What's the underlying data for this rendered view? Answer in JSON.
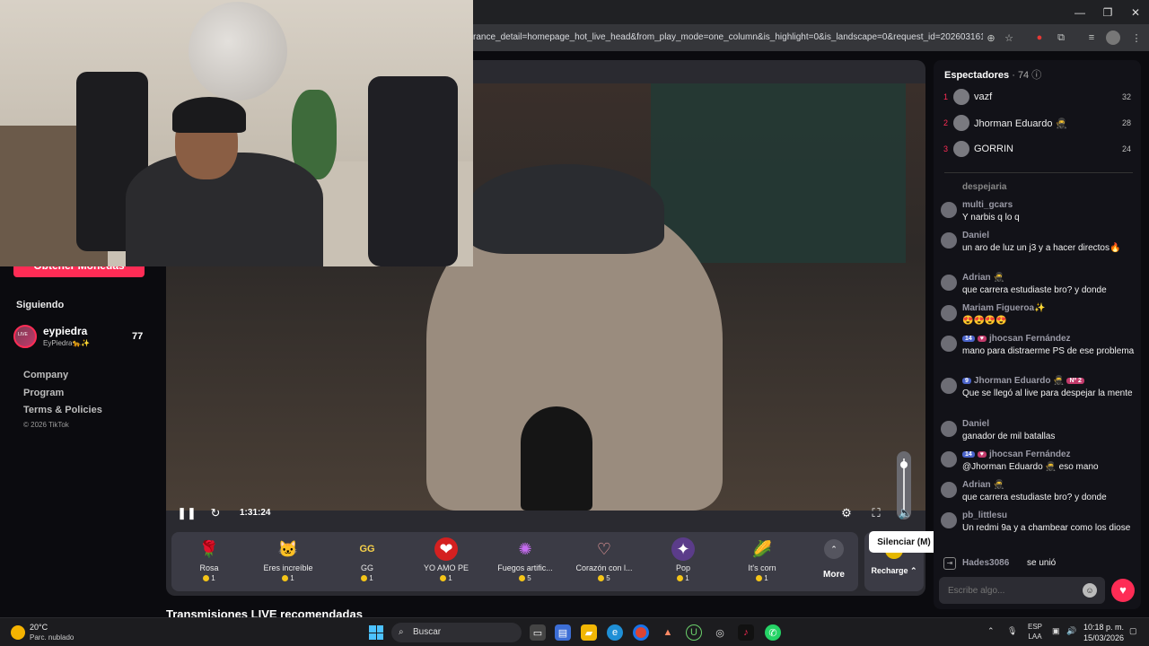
{
  "browser": {
    "url": "rance_detail=homepage_hot_live_head&from_play_mode=one_column&is_highlight=0&is_landscape=0&request_id=20260316111004..."
  },
  "sidebar": {
    "cta_label": "Obtener Monedas",
    "following_title": "Siguiendo",
    "following": [
      {
        "name": "eypiedra",
        "sub": "EyPiedra🐆✨",
        "count": "77",
        "live_tag": "LIVE"
      }
    ],
    "links": [
      "Company",
      "Program",
      "Terms & Policies"
    ],
    "copyright": "© 2026 TikTok"
  },
  "player": {
    "time": "1:31:24",
    "mute_tooltip": "Silenciar (M)",
    "gifts": [
      {
        "name": "Rosa",
        "price": "1",
        "icon": "🌹"
      },
      {
        "name": "Eres increíble",
        "price": "1",
        "icon": "🐱"
      },
      {
        "name": "GG",
        "price": "1",
        "icon": "GG"
      },
      {
        "name": "YO AMO PE",
        "price": "1",
        "icon": "❤"
      },
      {
        "name": "Fuegos artific...",
        "price": "5",
        "icon": "✺"
      },
      {
        "name": "Corazón con l...",
        "price": "5",
        "icon": "♡"
      },
      {
        "name": "Pop",
        "price": "1",
        "icon": "✦"
      },
      {
        "name": "It's corn",
        "price": "1",
        "icon": "🌽"
      }
    ],
    "more_label": "More",
    "recharge_label": "Recharge",
    "volume_level": 0.95
  },
  "recommended_title": "Transmisiones LIVE recomendadas",
  "chat": {
    "viewers_label": "Espectadores",
    "viewers_count": "· 74",
    "top": [
      {
        "rank": "1",
        "name": "vazf",
        "score": "32"
      },
      {
        "rank": "2",
        "name": "Jhorman Eduardo 🥷",
        "score": "28"
      },
      {
        "rank": "3",
        "name": "GORRIN",
        "score": "24"
      }
    ],
    "messages": [
      {
        "user": "",
        "text": "despejaria"
      },
      {
        "user": "multi_gcars",
        "text": "Y narbis q lo q"
      },
      {
        "user": "Daniel",
        "text": "un aro de luz un j3 y a hacer directos🔥"
      },
      {
        "user": "Adrian 🥷",
        "text": "que carrera estudiaste bro? y donde"
      },
      {
        "user": "Mariam Figueroa✨",
        "text": "😍😍😍😍"
      },
      {
        "user": "jhocsan Fernández",
        "badge": "14",
        "text": "mano para distraerme PS de ese problema"
      },
      {
        "user": "Jhorman Eduardo 🥷",
        "badge": "9",
        "badge2": "Nº 2",
        "text": "Que se llegó al live para despejar la mente"
      },
      {
        "user": "Daniel",
        "text": "ganador de mil batallas"
      },
      {
        "user": "jhocsan Fernández",
        "badge": "14",
        "text": "@Jhorman Eduardo 🥷 eso mano"
      },
      {
        "user": "Adrian 🥷",
        "text": "que carrera estudiaste bro? y donde"
      },
      {
        "user": "pb_littlesu",
        "text": "Un redmi 9a y a chambear como los diose"
      }
    ],
    "join_user": "Hades3086",
    "join_text": "se unió",
    "input_placeholder": "Escribe algo..."
  },
  "taskbar": {
    "weather_temp": "20°C",
    "weather_desc": "Parc. nublado",
    "search_label": "Buscar",
    "lang": "ESP",
    "lang_sub": "LAA",
    "time": "10:18 p. m.",
    "date": "15/03/2026"
  }
}
